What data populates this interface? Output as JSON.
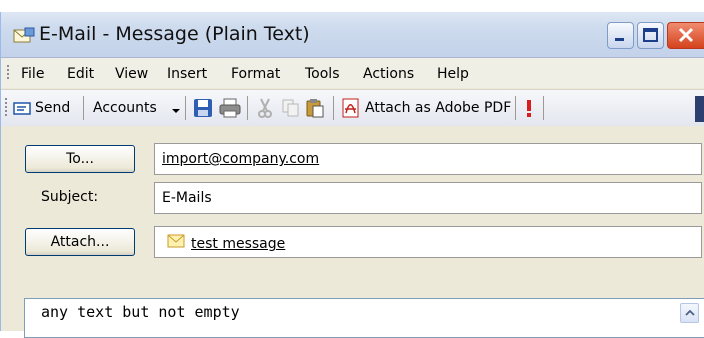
{
  "window": {
    "title": "E-Mail - Message (Plain Text)"
  },
  "menu": {
    "items": [
      "File",
      "Edit",
      "View",
      "Insert",
      "Format",
      "Tools",
      "Actions",
      "Help"
    ]
  },
  "toolbar": {
    "send": "Send",
    "accounts": "Accounts",
    "attach_pdf": "Attach as Adobe PDF"
  },
  "form": {
    "to_button": "To...",
    "to_value": "import@company.com",
    "subject_label": "Subject:",
    "subject_value": "E-Mails",
    "attach_button": "Attach...",
    "attachment_name": "test message"
  },
  "body": {
    "text": "any text but not empty"
  },
  "colors": {
    "title_bar": "#cfdcee",
    "close_button": "#d5421c",
    "toolbar": "#e4e6ef",
    "form_bg": "#ece9d8"
  }
}
